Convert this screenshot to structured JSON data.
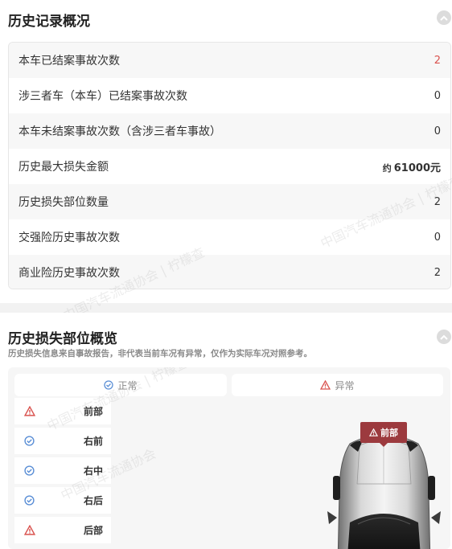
{
  "history_overview": {
    "title": "历史记录概况",
    "rows": [
      {
        "label": "本车已结案事故次数",
        "value": "2",
        "highlight": true
      },
      {
        "label": "涉三者车（本车）已结案事故次数",
        "value": "0"
      },
      {
        "label": "本车未结案事故次数（含涉三者车事故）",
        "value": "0"
      },
      {
        "label": "历史最大损失金额",
        "prefix": "约",
        "value": "61000元",
        "bold": true
      },
      {
        "label": "历史损失部位数量",
        "value": "2"
      },
      {
        "label": "交强险历史事故次数",
        "value": "0"
      },
      {
        "label": "商业险历史事故次数",
        "value": "2"
      }
    ]
  },
  "damage_overview": {
    "title": "历史损失部位概览",
    "subtitle": "历史损失信息来自事故报告，非代表当前车况有异常，仅作为实际车况对照参考。",
    "legend": {
      "normal": "正常",
      "abnormal": "异常"
    },
    "parts": [
      {
        "label": "前部",
        "status": "abnormal"
      },
      {
        "label": "右前",
        "status": "normal"
      },
      {
        "label": "右中",
        "status": "normal"
      },
      {
        "label": "右后",
        "status": "normal"
      },
      {
        "label": "后部",
        "status": "abnormal"
      }
    ],
    "car_tag": "前部"
  },
  "colors": {
    "accent_red": "#d9534f",
    "normal_blue": "#5b8fd6",
    "tag_bg": "#9c3a3e"
  },
  "watermark": {
    "text": "中国汽车流通协会",
    "brand": "柠檬查"
  },
  "icons": [
    "chevron-up-icon",
    "check-circle-icon",
    "warning-triangle-icon",
    "car-image"
  ]
}
